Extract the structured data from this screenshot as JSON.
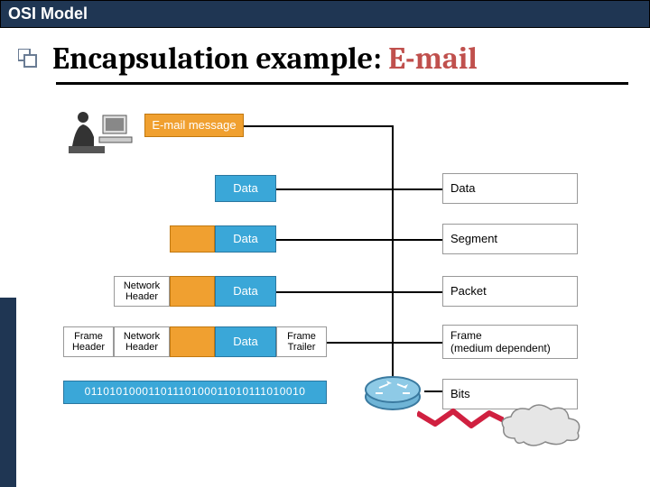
{
  "header": {
    "title": "OSI Model"
  },
  "slide": {
    "title_pre": "Encapsulation example: ",
    "title_em": "E-mail"
  },
  "diagram": {
    "email_label": "E-mail message",
    "data_label": "Data",
    "network_header": "Network\nHeader",
    "frame_header": "Frame\nHeader",
    "frame_trailer": "Frame\nTrailer",
    "bits_stream": "01101010001101110100011010111010010",
    "right": {
      "data": "Data",
      "segment": "Segment",
      "packet": "Packet",
      "frame": "Frame\n(medium dependent)",
      "bits": "Bits"
    }
  },
  "icons": {
    "bullet": "square-bullet-icon",
    "user": "person-at-computer-icon",
    "router": "router-device-icon",
    "cloud": "network-cloud-icon",
    "wire": "zigzag-cable-icon"
  }
}
